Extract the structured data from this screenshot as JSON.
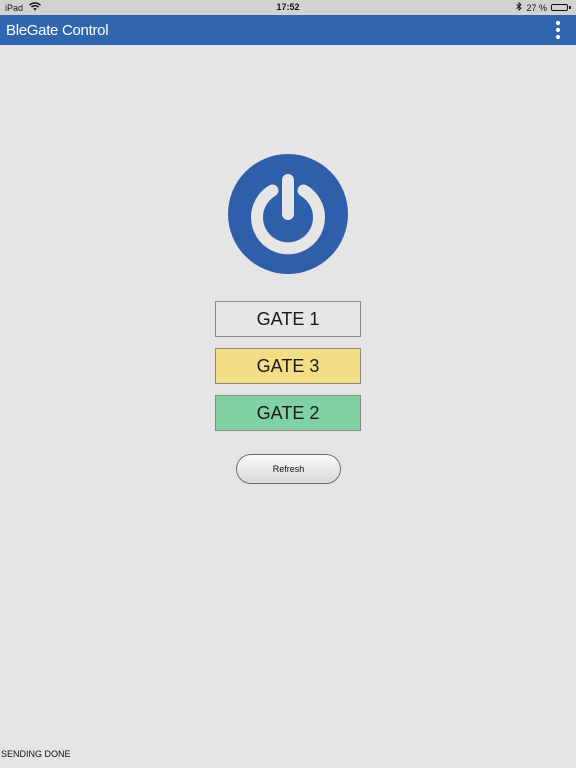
{
  "status_bar": {
    "device": "iPad",
    "time": "17:52",
    "battery_text": "27 %",
    "battery_level": 0.27,
    "wifi_icon": "wifi-icon",
    "bluetooth_icon": "bluetooth-icon"
  },
  "app_bar": {
    "title": "BleGate Control",
    "menu_icon": "more-vertical-icon",
    "color": "#3065b0"
  },
  "power": {
    "icon": "power-icon",
    "color": "#2f5fab"
  },
  "gates": [
    {
      "label": "GATE 1",
      "color": "#e6e6e6"
    },
    {
      "label": "GATE 3",
      "color": "#f4de85"
    },
    {
      "label": "GATE 2",
      "color": "#80d1a3"
    }
  ],
  "refresh_label": "Refresh",
  "status_message": "SENDING DONE"
}
